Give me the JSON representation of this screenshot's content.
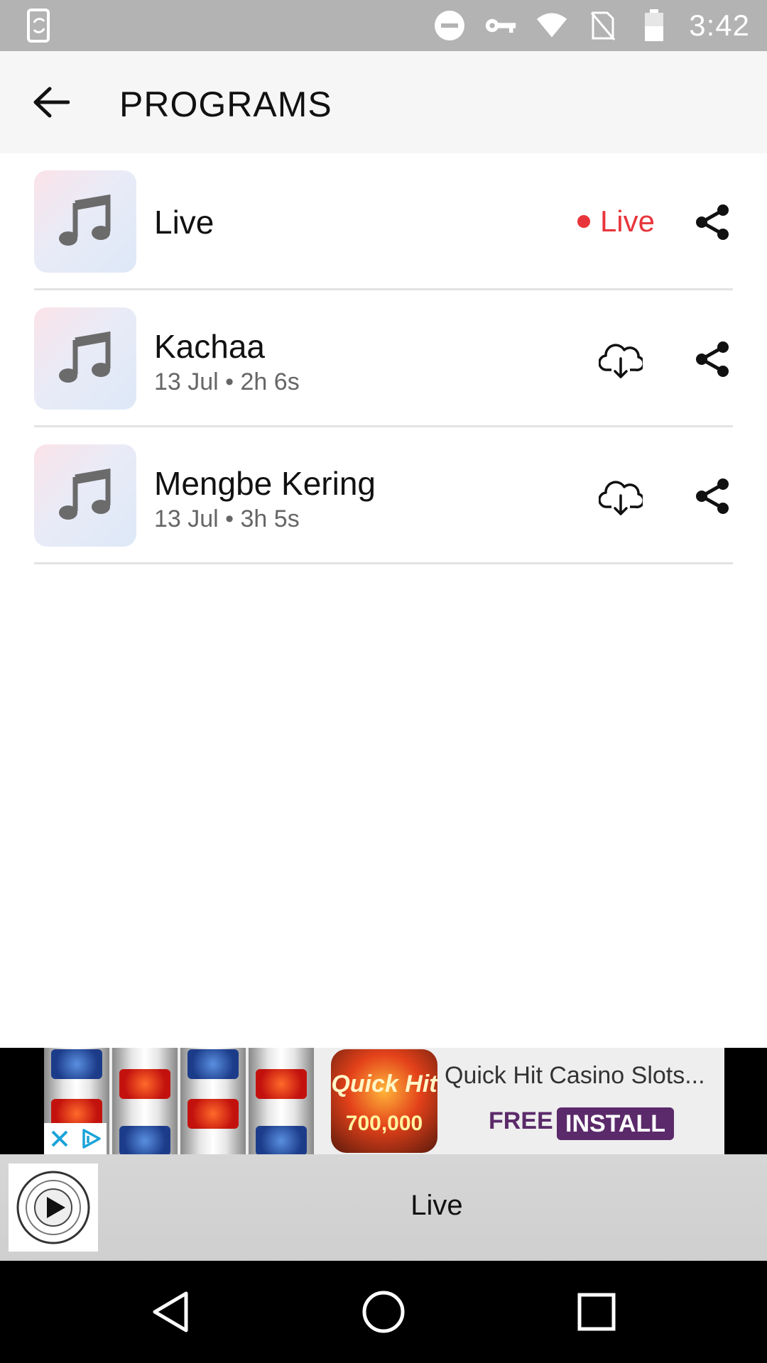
{
  "status_bar": {
    "time": "3:42",
    "icons": [
      "phone-sync-icon",
      "do-not-disturb-icon",
      "vpn-key-icon",
      "wifi-icon",
      "no-sim-icon",
      "battery-icon"
    ]
  },
  "app_bar": {
    "title": "PROGRAMS",
    "back_icon": "arrow-left-icon"
  },
  "programs": [
    {
      "title": "Live",
      "meta": "",
      "status": "Live",
      "action": "share"
    },
    {
      "title": "Kachaa",
      "meta": "13 Jul • 2h 6s",
      "action": "download"
    },
    {
      "title": "Mengbe Kering",
      "meta": "13 Jul • 3h 5s",
      "action": "download"
    }
  ],
  "ad": {
    "brand": "Quick Hit",
    "amount": "700,000",
    "title": "Quick Hit Casino Slots...",
    "free_label": "FREE",
    "install_label": "INSTALL"
  },
  "mini_player": {
    "title": "Live",
    "logo_icon": "radio-logo-play-icon"
  },
  "colors": {
    "live_red": "#e8353b",
    "ad_purple": "#5b2a6a",
    "status_bar": "#b3b3b3"
  }
}
